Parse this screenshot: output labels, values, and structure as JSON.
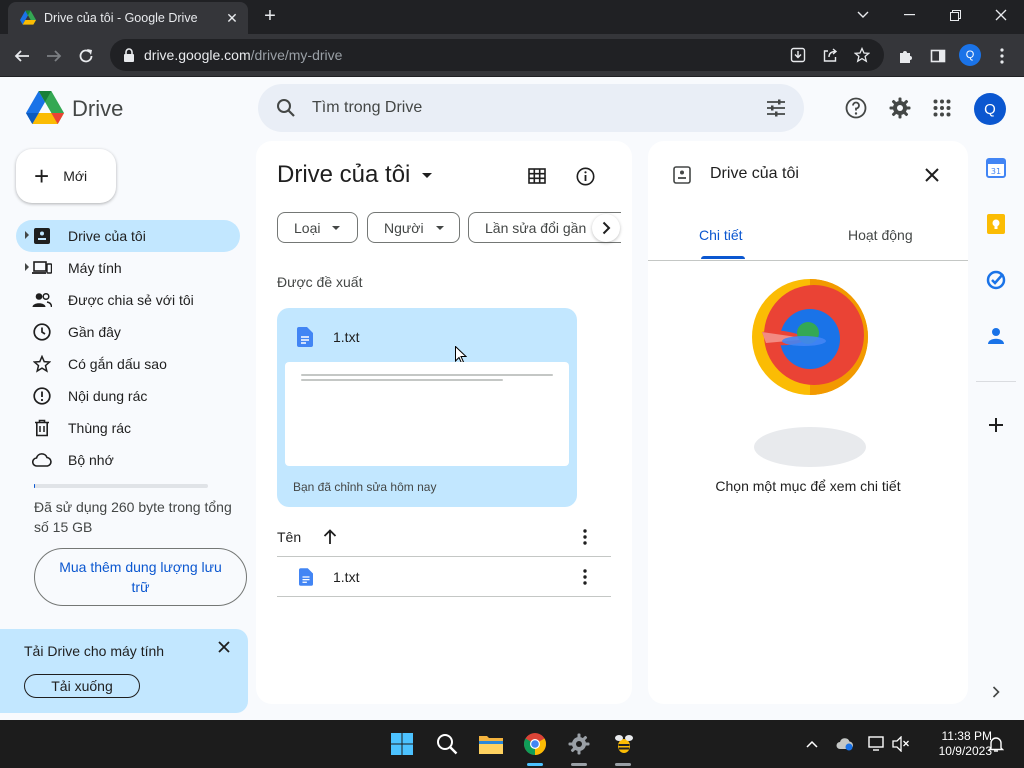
{
  "browser": {
    "tab_title": "Drive của tôi - Google Drive",
    "url_host": "drive.google.com",
    "url_path": "/drive/my-drive",
    "profile_initial": "Q"
  },
  "header": {
    "logo_text": "Drive",
    "search_placeholder": "Tìm trong Drive",
    "avatar_initial": "Q"
  },
  "sidebar": {
    "new_label": "Mới",
    "items": [
      {
        "label": "Drive của tôi"
      },
      {
        "label": "Máy tính"
      },
      {
        "label": "Được chia sẻ với tôi"
      },
      {
        "label": "Gần đây"
      },
      {
        "label": "Có gắn dấu sao"
      },
      {
        "label": "Nội dung rác"
      },
      {
        "label": "Thùng rác"
      },
      {
        "label": "Bộ nhớ"
      }
    ],
    "storage_text": "Đã sử dụng 260 byte trong tổng số 15 GB",
    "buy_storage_label": "Mua thêm dung lượng lưu trữ",
    "promo_title": "Tải Drive cho máy tính",
    "promo_button": "Tải xuống"
  },
  "main": {
    "title": "Drive của tôi",
    "filters": [
      "Loại",
      "Người",
      "Lần sửa đổi gần"
    ],
    "suggested_label": "Được đề xuất",
    "suggested_file": {
      "name": "1.txt",
      "edited": "Bạn đã chỉnh sửa hôm nay"
    },
    "list_header_name": "Tên",
    "files": [
      {
        "name": "1.txt"
      }
    ]
  },
  "details": {
    "title": "Drive của tôi",
    "tabs": [
      "Chi tiết",
      "Hoạt động"
    ],
    "empty_text": "Chọn một mục để xem chi tiết"
  },
  "taskbar": {
    "time": "11:38 PM",
    "date": "10/9/2023"
  },
  "colors": {
    "accent": "#0b57d0",
    "selected_bg": "#c2e7ff",
    "page_bg": "#f8fafd"
  }
}
